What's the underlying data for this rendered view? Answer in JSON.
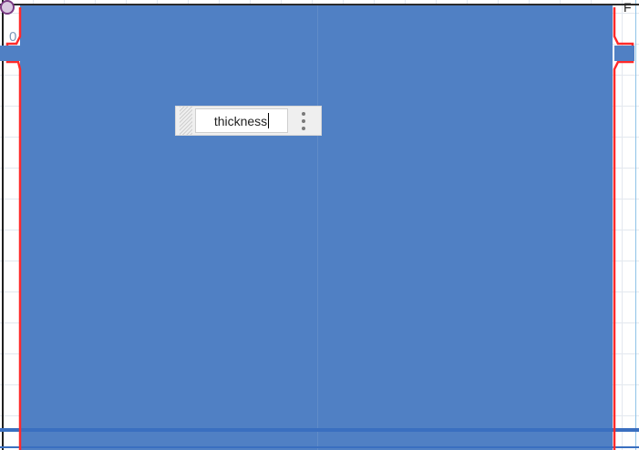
{
  "canvas": {
    "origin_label": "0",
    "corner_label": "F"
  },
  "mini_toolbar": {
    "name_field_value": "thickness",
    "more_icon": "kebab-menu-icon",
    "drag_icon": "drag-handle-icon"
  },
  "colors": {
    "solid_fill": "#5080c4",
    "profile_edge": "#ff2a2a",
    "axis": "#1f1f1f",
    "grid": "#e3e8ef"
  }
}
